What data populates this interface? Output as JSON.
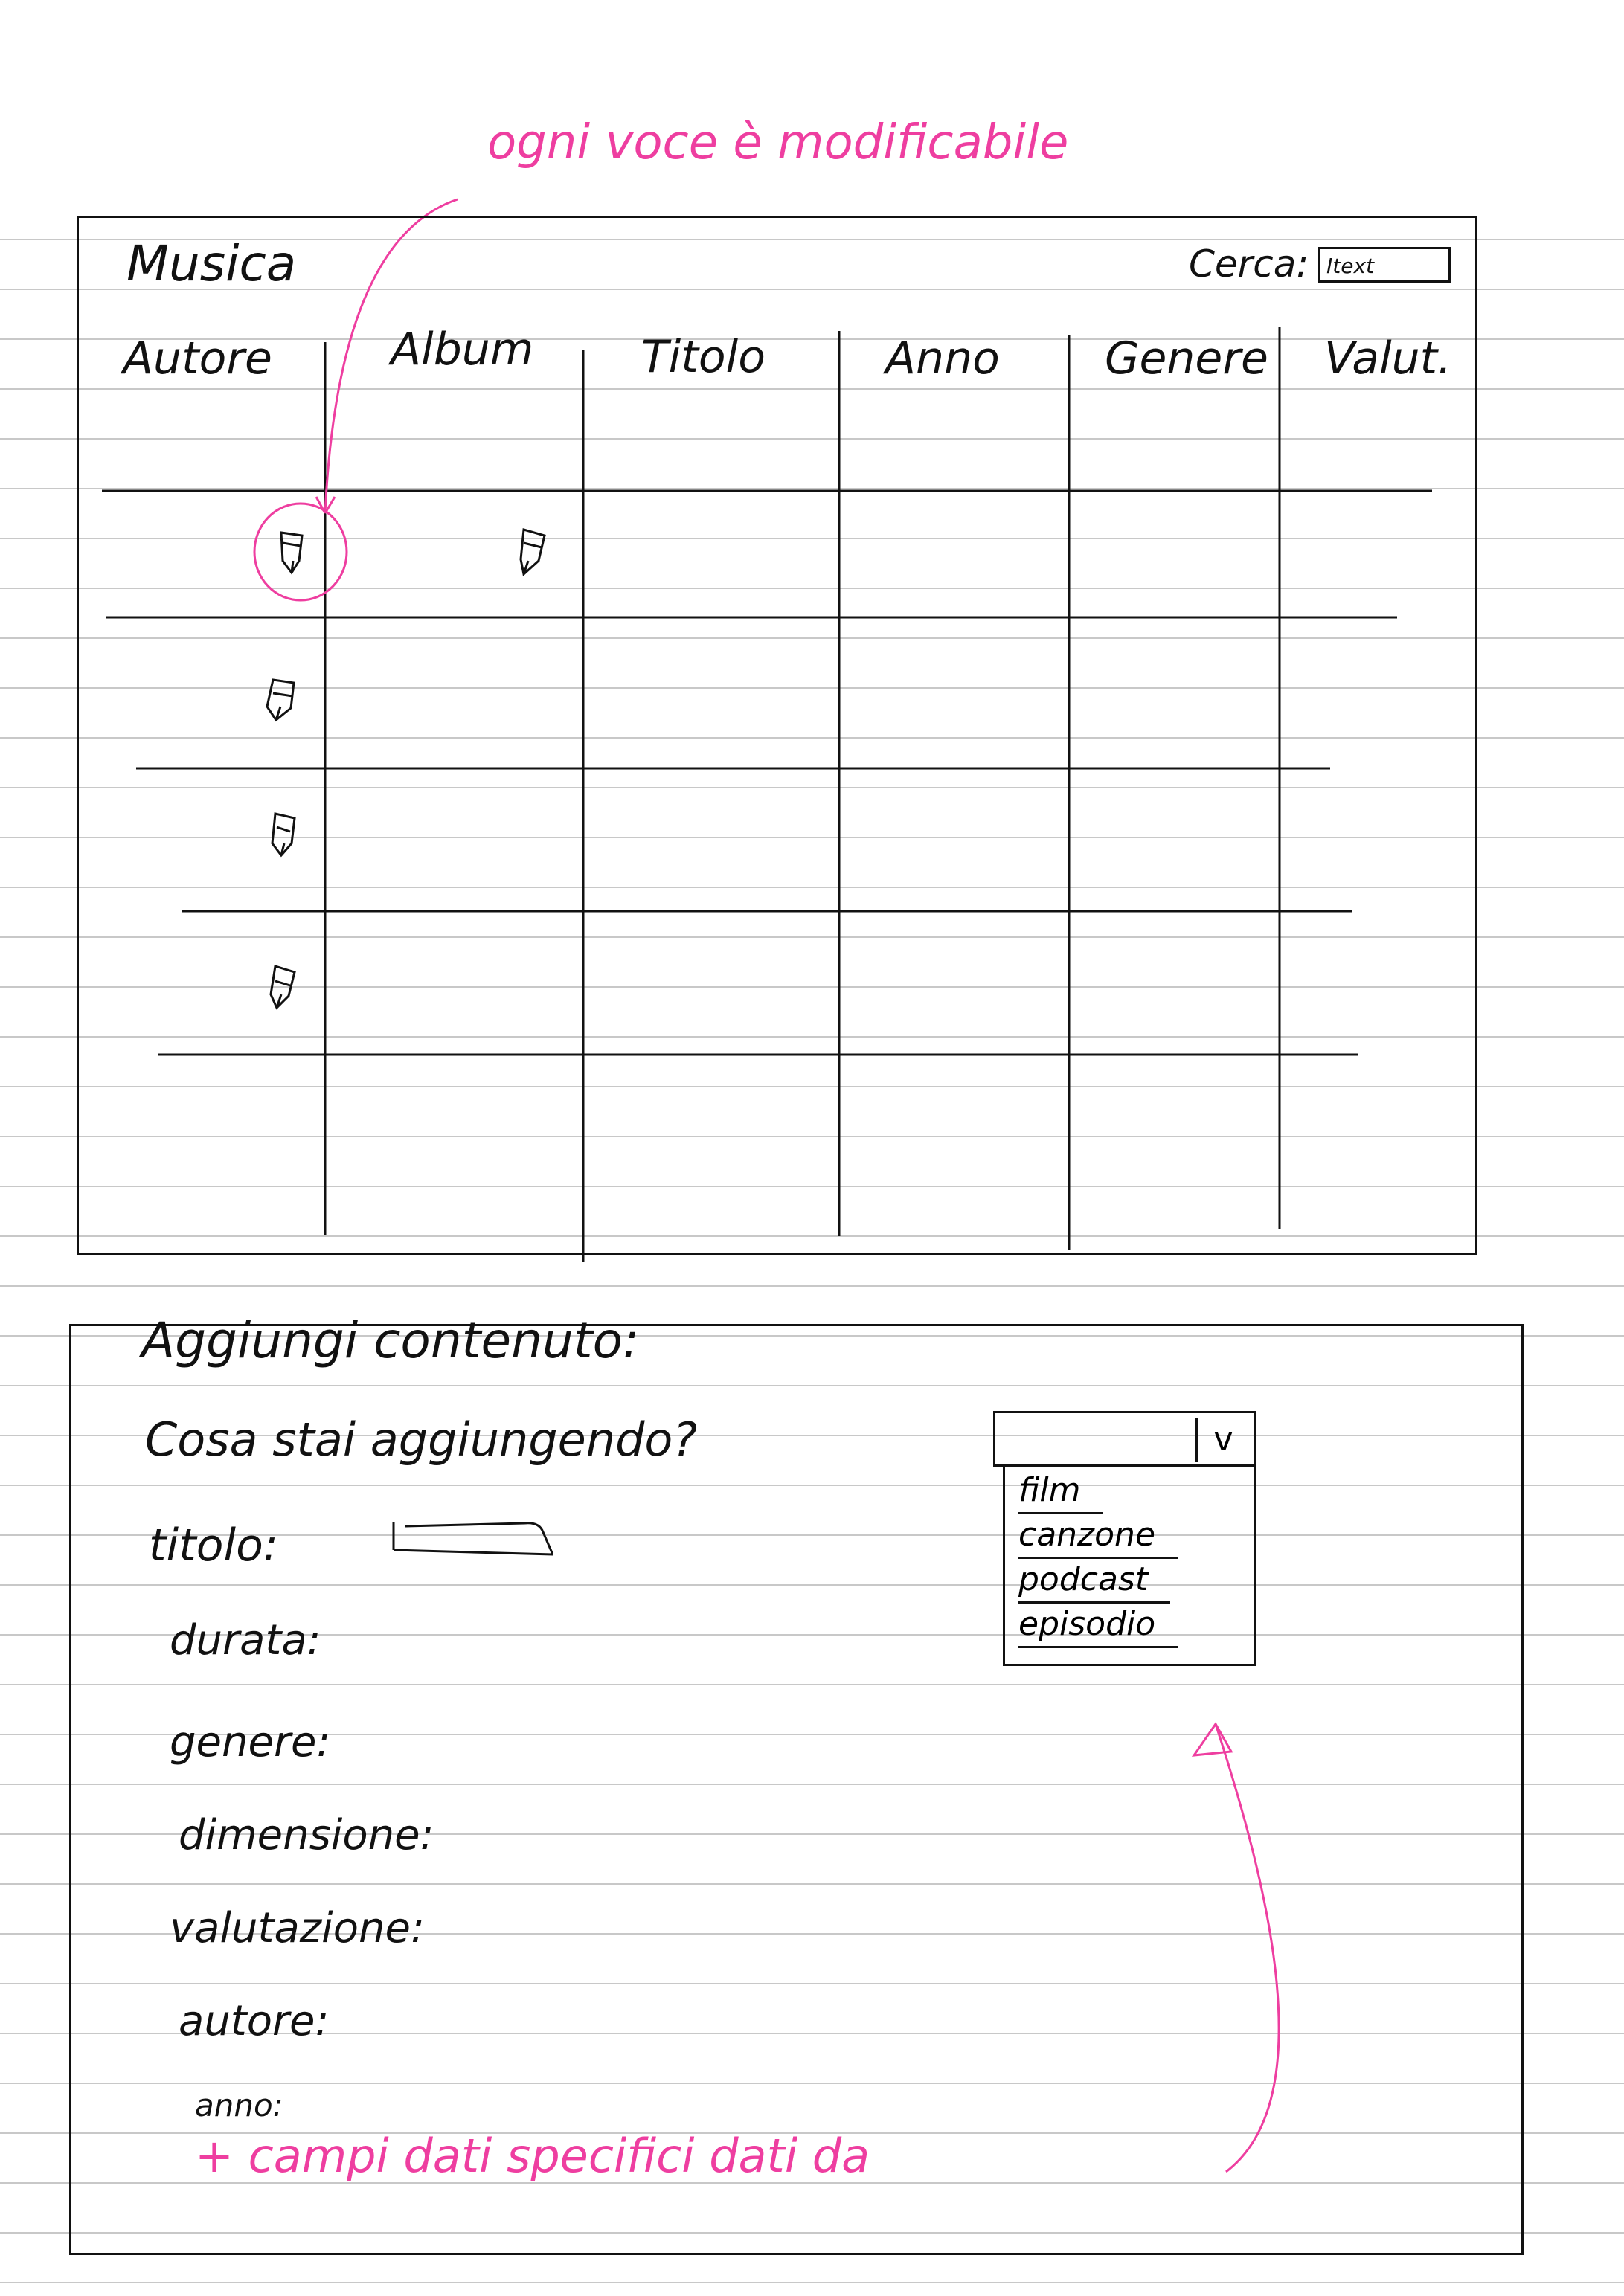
{
  "annotations": {
    "editable_note": "ogni voce è modificabile",
    "dropdown_note": "+ campi dati specifici dati da"
  },
  "music_table": {
    "title": "Musica",
    "search_label": "Cerca:",
    "search_value": "Itext",
    "columns": [
      "Autore",
      "Album",
      "Titolo",
      "Anno",
      "Genere",
      "Valut."
    ],
    "rows": 4,
    "edit_icon": "pencil-edit-icon"
  },
  "add_form": {
    "title": "Aggiungi contenuto:",
    "question": "Cosa stai aggiungendo?",
    "fields": [
      "titolo:",
      "durata:",
      "genere:",
      "dimensione:",
      "valutazione:",
      "autore:",
      "anno:"
    ],
    "dropdown": {
      "toggle_glyph": "v",
      "options": [
        "film",
        "canzone",
        "podcast",
        "episodio"
      ]
    }
  },
  "colors": {
    "ink": "#111111",
    "annotation": "#ee3ea0",
    "ruled_line": "#c8c8c8"
  }
}
